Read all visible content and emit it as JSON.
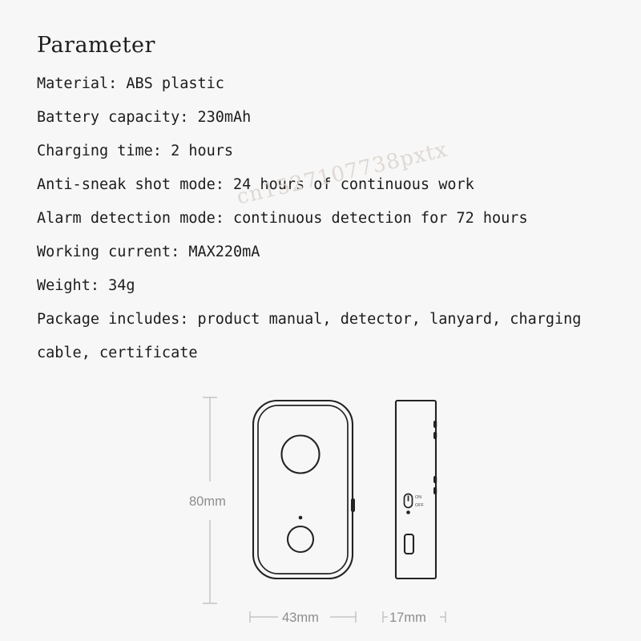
{
  "document": {
    "title": "Parameter",
    "background_color": "#f7f7f7",
    "text_color": "#1c1c1c"
  },
  "specs": [
    "Material: ABS plastic",
    "Battery capacity: 230mAh",
    "Charging time: 2 hours",
    "Anti-sneak shot mode: 24 hours of continuous work",
    "Alarm detection mode: continuous detection for 72 hours",
    "Working current: MAX220mA",
    "Weight: 34g",
    "Package includes: product manual, detector, lanyard, charging",
    "cable, certificate"
  ],
  "watermark": {
    "text": "cn1527107738pxtx",
    "color": "#ded7d2"
  },
  "diagram": {
    "dimensions": {
      "height_label": "80mm",
      "front_width_label": "43mm",
      "side_width_label": "17mm"
    },
    "side_view": {
      "switch_on_label": "ON",
      "switch_off_label": "OFF"
    }
  }
}
